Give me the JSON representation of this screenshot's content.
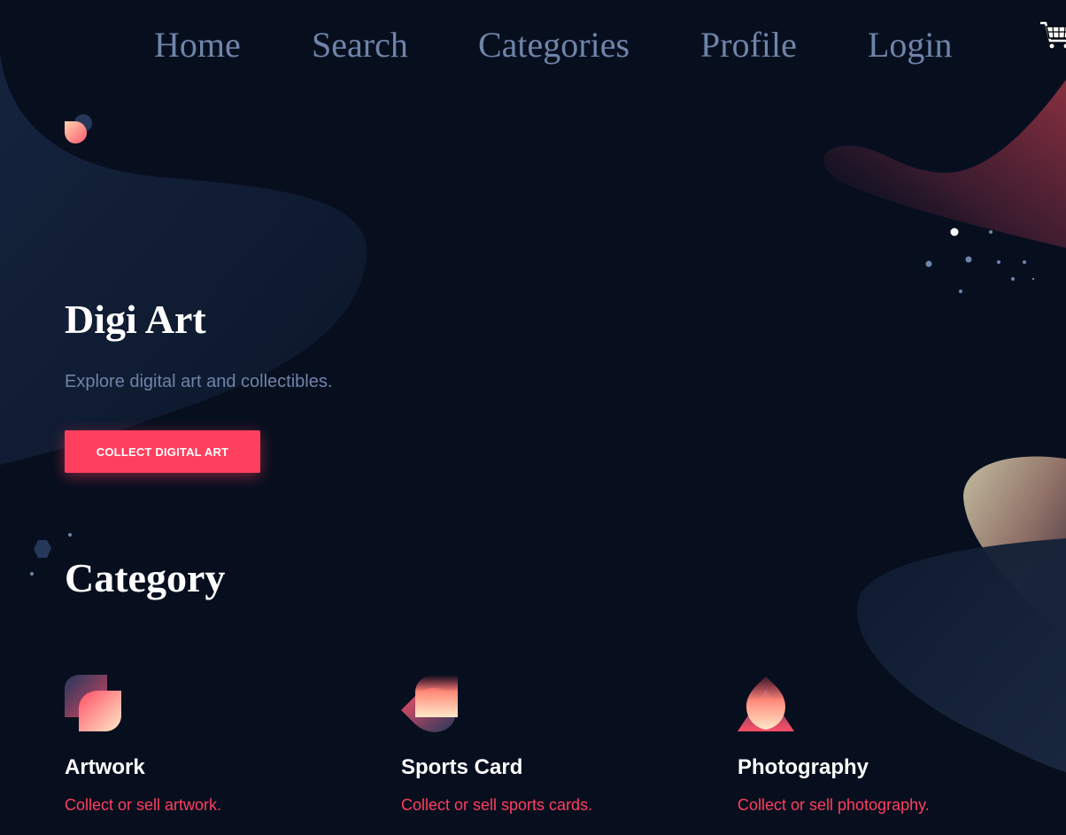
{
  "nav": {
    "items": [
      {
        "label": "Home"
      },
      {
        "label": "Search"
      },
      {
        "label": "Categories"
      },
      {
        "label": "Profile"
      },
      {
        "label": "Login"
      }
    ],
    "cart_icon": "shopping-cart-icon"
  },
  "hero": {
    "title": "Digi Art",
    "subtitle": "Explore digital art and collectibles.",
    "cta_label": "COLLECT DIGITAL ART"
  },
  "category_section": {
    "title": "Category",
    "items": [
      {
        "title": "Artwork",
        "description": "Collect or sell artwork.",
        "icon": "artwork-icon"
      },
      {
        "title": "Sports Card",
        "description": "Collect or sell sports cards.",
        "icon": "sports-card-icon"
      },
      {
        "title": "Photography",
        "description": "Collect or sell photography.",
        "icon": "photography-icon"
      }
    ]
  },
  "colors": {
    "background": "#070f1f",
    "nav_text": "#6f84a8",
    "accent": "#ff3f5e",
    "heading": "#ffffff"
  }
}
